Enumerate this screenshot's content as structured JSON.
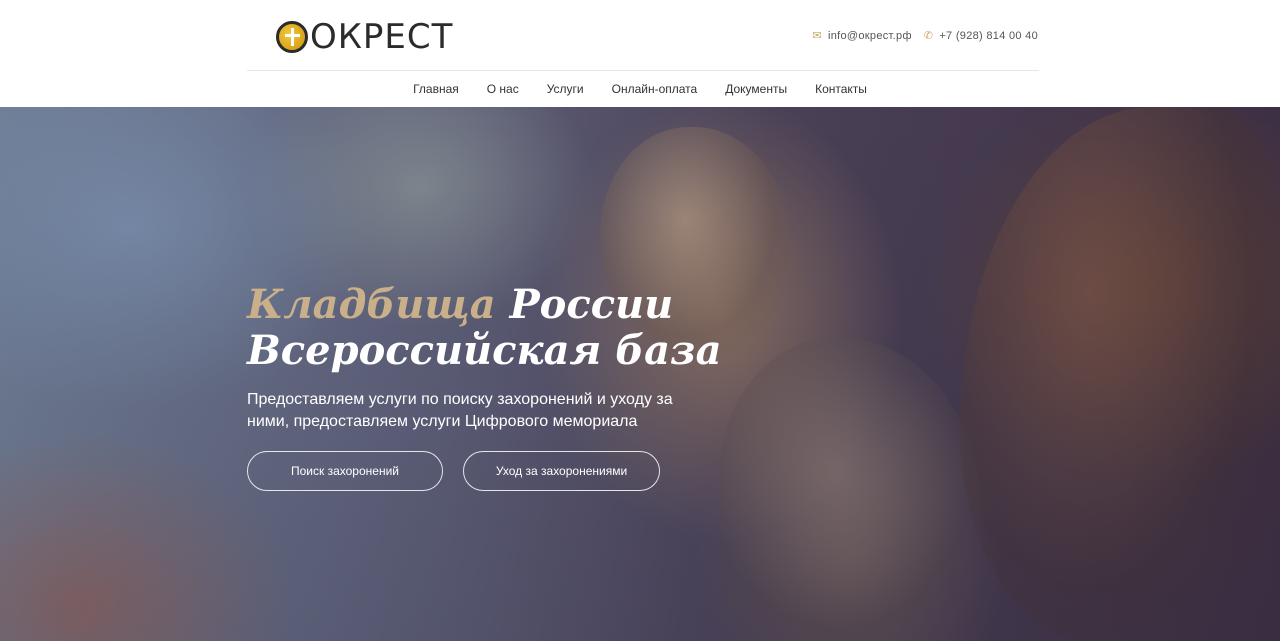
{
  "header": {
    "logo_text": "ОКРЕСТ",
    "email": "info@окрест.рф",
    "phone": "+7 (928) 814 00 40",
    "email_icon": "envelope-icon",
    "phone_icon": "phone-icon"
  },
  "nav": {
    "items": [
      {
        "label": "Главная"
      },
      {
        "label": "О нас"
      },
      {
        "label": "Услуги"
      },
      {
        "label": "Онлайн-оплата"
      },
      {
        "label": "Документы"
      },
      {
        "label": "Контакты"
      }
    ]
  },
  "hero": {
    "title_accent": "Кладбища",
    "title_rest": " России",
    "title_line2": "Всероссийская база",
    "subtitle": "Предоставляем услуги по поиску захоронений и уходу за ними, предоставляем услуги Цифрового мемориала",
    "button_search": "Поиск захоронений",
    "button_care": "Уход за захоронениями"
  },
  "colors": {
    "accent_gold": "#c9a961",
    "title_accent": "#c9b08a",
    "text_dark": "#333333"
  }
}
